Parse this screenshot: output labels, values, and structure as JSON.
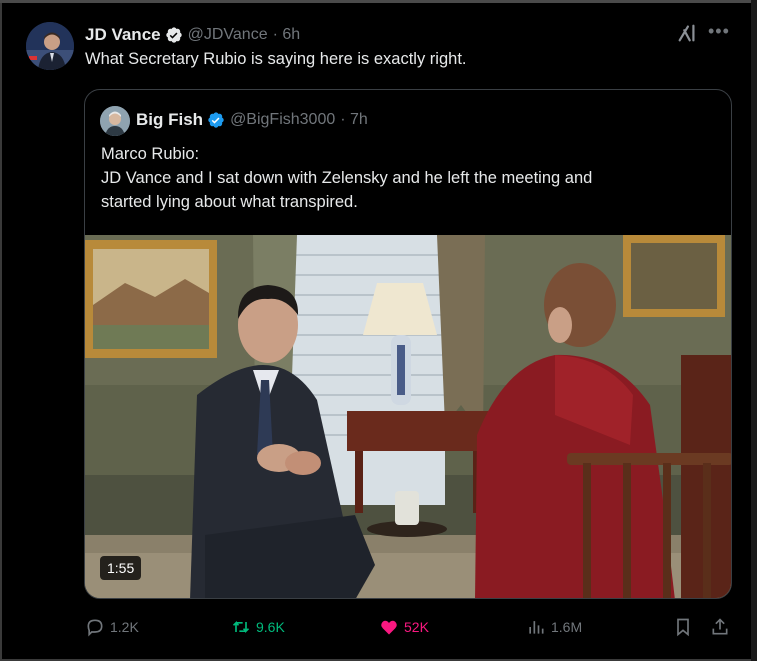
{
  "tweet": {
    "author_name": "JD Vance",
    "handle": "@JDVance",
    "time": "· 6h",
    "text": "What Secretary Rubio is saying here is exactly right."
  },
  "quoted_tweet": {
    "author_name": "Big Fish",
    "handle": "@BigFish3000",
    "time": "· 7h",
    "text_lines": [
      "Marco Rubio:",
      "JD Vance and I sat down with Zelensky and he left the meeting and",
      "started lying about what transpired."
    ],
    "video_duration": "1:55"
  },
  "actions": {
    "replies": "1.2K",
    "reposts": "9.6K",
    "likes": "52K",
    "views": "1.6M"
  },
  "colors": {
    "background": "#000000",
    "text_primary": "#e7e9ea",
    "text_secondary": "#71767b",
    "verified_badge": "#1d9bf0",
    "repost_active": "#00ba7c",
    "like_active": "#f91880",
    "border": "#3a3f44"
  },
  "icons": {
    "verified": "verified-badge-icon",
    "grok": "grok-icon",
    "more": "more-icon",
    "reply": "reply-icon",
    "repost": "repost-icon",
    "like": "heart-icon",
    "views": "views-icon",
    "bookmark": "bookmark-icon",
    "share": "share-icon"
  }
}
